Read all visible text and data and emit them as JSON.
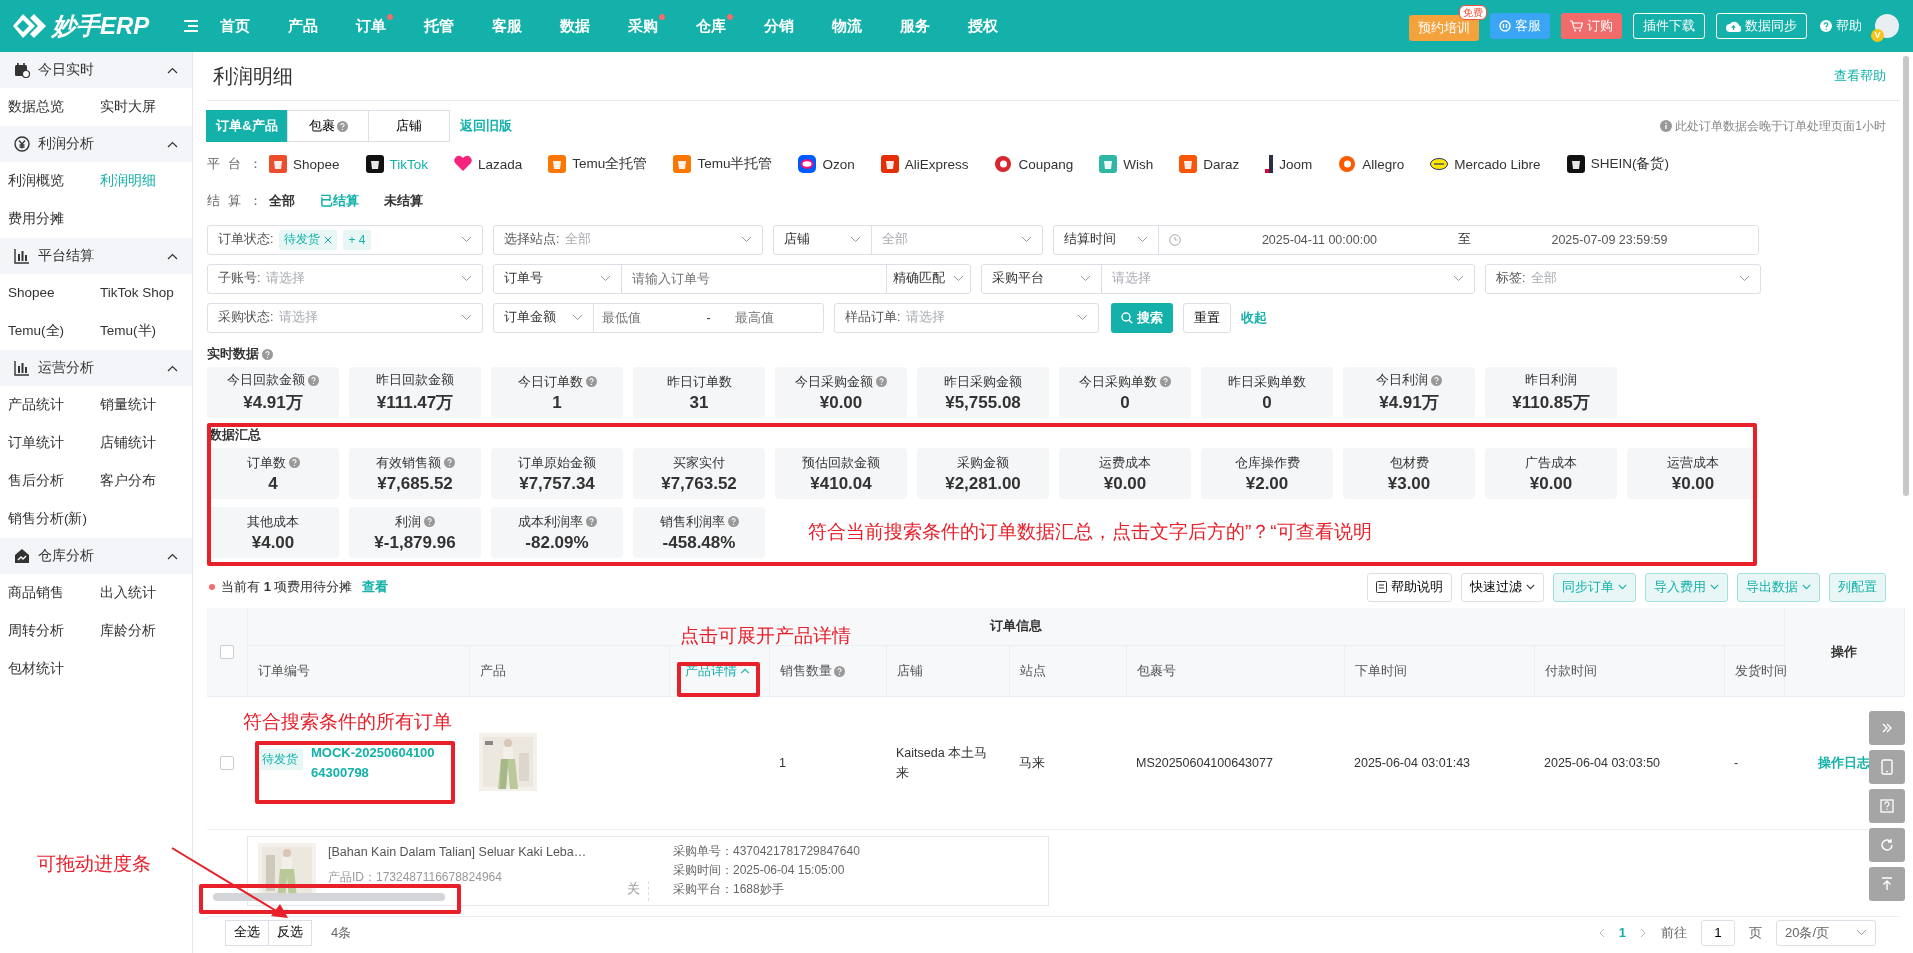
{
  "header": {
    "logo": "妙手ERP",
    "nav": [
      {
        "label": "首页",
        "dot": false
      },
      {
        "label": "产品",
        "dot": false
      },
      {
        "label": "订单",
        "dot": true
      },
      {
        "label": "托管",
        "dot": false
      },
      {
        "label": "客服",
        "dot": false
      },
      {
        "label": "数据",
        "dot": false
      },
      {
        "label": "采购",
        "dot": true
      },
      {
        "label": "仓库",
        "dot": true
      },
      {
        "label": "分销",
        "dot": false
      },
      {
        "label": "物流",
        "dot": false
      },
      {
        "label": "服务",
        "dot": false
      },
      {
        "label": "授权",
        "dot": false
      }
    ],
    "actions": [
      {
        "kind": "training",
        "label": "预约培训",
        "badge": "免费"
      },
      {
        "kind": "service",
        "label": "客服"
      },
      {
        "kind": "order",
        "label": "订购"
      },
      {
        "kind": "outline",
        "label": "插件下载"
      },
      {
        "kind": "sync",
        "label": "数据同步"
      },
      {
        "kind": "help",
        "label": "帮助"
      }
    ],
    "avatar_badge": "V"
  },
  "sidebar": {
    "sections": [
      {
        "title": "今日实时",
        "expanded": true,
        "items": [
          {
            "label": "数据总览",
            "selected": false
          },
          {
            "label": "实时大屏",
            "selected": false
          }
        ]
      },
      {
        "title": "利润分析",
        "expanded": true,
        "items": [
          {
            "label": "利润概览",
            "selected": false
          },
          {
            "label": "利润明细",
            "selected": true
          },
          {
            "label": "费用分摊",
            "selected": false
          }
        ]
      },
      {
        "title": "平台结算",
        "expanded": true,
        "items": [
          {
            "label": "Shopee",
            "selected": false
          },
          {
            "label": "TikTok Shop",
            "selected": false
          },
          {
            "label": "Temu(全)",
            "selected": false
          },
          {
            "label": "Temu(半)",
            "selected": false
          }
        ]
      },
      {
        "title": "运营分析",
        "expanded": true,
        "items": [
          {
            "label": "产品统计",
            "selected": false
          },
          {
            "label": "销量统计",
            "selected": false
          },
          {
            "label": "订单统计",
            "selected": false
          },
          {
            "label": "店铺统计",
            "selected": false
          },
          {
            "label": "售后分析",
            "selected": false
          },
          {
            "label": "客户分布",
            "selected": false
          },
          {
            "label": "销售分析(新)",
            "selected": false
          }
        ]
      },
      {
        "title": "仓库分析",
        "expanded": true,
        "items": [
          {
            "label": "商品销售",
            "selected": false
          },
          {
            "label": "出入统计",
            "selected": false
          },
          {
            "label": "周转分析",
            "selected": false
          },
          {
            "label": "库龄分析",
            "selected": false
          },
          {
            "label": "包材统计",
            "selected": false
          }
        ]
      }
    ]
  },
  "page": {
    "title": "利润明细",
    "help_link": "查看帮助",
    "tabs": [
      {
        "label": "订单&产品",
        "selected": true,
        "help": false
      },
      {
        "label": "包裹",
        "selected": false,
        "help": true
      },
      {
        "label": "店铺",
        "selected": false,
        "help": false
      }
    ],
    "legacy_link": "返回旧版",
    "notice": "此处订单数据会晚于订单处理页面1小时",
    "platform_label": "平台：",
    "platforms": [
      {
        "name": "Shopee",
        "selected": false
      },
      {
        "name": "TikTok",
        "selected": true
      },
      {
        "name": "Lazada",
        "selected": false
      },
      {
        "name": "Temu全托管",
        "selected": false
      },
      {
        "name": "Temu半托管",
        "selected": false
      },
      {
        "name": "Ozon",
        "selected": false
      },
      {
        "name": "AliExpress",
        "selected": false
      },
      {
        "name": "Coupang",
        "selected": false
      },
      {
        "name": "Wish",
        "selected": false
      },
      {
        "name": "Daraz",
        "selected": false
      },
      {
        "name": "Joom",
        "selected": false
      },
      {
        "name": "Allegro",
        "selected": false
      },
      {
        "name": "Mercado Libre",
        "selected": false
      },
      {
        "name": "SHEIN(备货)",
        "selected": false
      }
    ],
    "settlement_label": "结算：",
    "settlement_options": [
      {
        "label": "全部",
        "selected": false
      },
      {
        "label": "已结算",
        "selected": true
      },
      {
        "label": "未结算",
        "selected": false
      }
    ]
  },
  "filters": {
    "rows": [
      [
        {
          "kind": "select",
          "label": "订单状态:",
          "tags": [
            "待发货",
            "+ 4"
          ]
        },
        {
          "kind": "select",
          "label": "选择站点:",
          "placeholder": "全部"
        },
        {
          "kind": "combo",
          "option": "店铺",
          "placeholder": "全部"
        },
        {
          "kind": "daterange",
          "option": "结算时间",
          "start": "2025-04-11 00:00:00",
          "separator": "至",
          "end": "2025-07-09 23:59:59"
        }
      ],
      [
        {
          "kind": "select",
          "label": "子账号:",
          "placeholder": "请选择"
        },
        {
          "kind": "combo_input",
          "option": "订单号",
          "placeholder": "请输入订单号",
          "mode": "精确匹配"
        },
        {
          "kind": "combo",
          "option": "采购平台",
          "placeholder": "请选择"
        },
        {
          "kind": "select",
          "label": "标签:",
          "placeholder": "全部"
        }
      ],
      [
        {
          "kind": "select",
          "label": "采购状态:",
          "placeholder": "请选择"
        },
        {
          "kind": "range",
          "option": "订单金额",
          "min_placeholder": "最低值",
          "separator": "-",
          "max_placeholder": "最高值"
        },
        {
          "kind": "select",
          "label": "样品订单:",
          "placeholder": "请选择"
        }
      ]
    ],
    "search_button": "搜索",
    "reset_button": "重置",
    "collapse_link": "收起"
  },
  "realtime": {
    "title": "实时数据",
    "cards": [
      {
        "label": "今日回款金额",
        "help": true,
        "value": "¥4.91万"
      },
      {
        "label": "昨日回款金额",
        "help": false,
        "value": "¥111.47万"
      },
      {
        "label": "今日订单数",
        "help": true,
        "value": "1"
      },
      {
        "label": "昨日订单数",
        "help": false,
        "value": "31"
      },
      {
        "label": "今日采购金额",
        "help": true,
        "value": "¥0.00"
      },
      {
        "label": "昨日采购金额",
        "help": false,
        "value": "¥5,755.08"
      },
      {
        "label": "今日采购单数",
        "help": true,
        "value": "0"
      },
      {
        "label": "昨日采购单数",
        "help": false,
        "value": "0"
      },
      {
        "label": "今日利润",
        "help": true,
        "value": "¥4.91万"
      },
      {
        "label": "昨日利润",
        "help": false,
        "value": "¥110.85万"
      }
    ]
  },
  "summary": {
    "title": "数据汇总",
    "cards": [
      {
        "label": "订单数",
        "help": true,
        "value": "4"
      },
      {
        "label": "有效销售额",
        "help": true,
        "value": "¥7,685.52"
      },
      {
        "label": "订单原始金额",
        "help": false,
        "value": "¥7,757.34"
      },
      {
        "label": "买家实付",
        "help": false,
        "value": "¥7,763.52"
      },
      {
        "label": "预估回款金额",
        "help": false,
        "value": "¥410.04"
      },
      {
        "label": "采购金额",
        "help": false,
        "value": "¥2,281.00"
      },
      {
        "label": "运费成本",
        "help": false,
        "value": "¥0.00"
      },
      {
        "label": "仓库操作费",
        "help": false,
        "value": "¥2.00"
      },
      {
        "label": "包材费",
        "help": false,
        "value": "¥3.00"
      },
      {
        "label": "广告成本",
        "help": false,
        "value": "¥0.00"
      },
      {
        "label": "运营成本",
        "help": false,
        "value": "¥0.00"
      },
      {
        "label": "其他成本",
        "help": false,
        "value": "¥4.00"
      },
      {
        "label": "利润",
        "help": true,
        "value": "¥-1,879.96"
      },
      {
        "label": "成本利润率",
        "help": true,
        "value": "-82.09%"
      },
      {
        "label": "销售利润率",
        "help": true,
        "value": "-458.48%"
      }
    ]
  },
  "toolbar": {
    "notice": "当前有 **1** 项费用待分摊",
    "notice_link": "查看",
    "buttons": [
      {
        "kind": "doc",
        "label": "帮助说明"
      },
      {
        "kind": "plain_menu",
        "label": "快速过滤"
      },
      {
        "kind": "accent_menu",
        "label": "同步订单"
      },
      {
        "kind": "accent_menu",
        "label": "导入费用"
      },
      {
        "kind": "accent_menu",
        "label": "导出数据"
      },
      {
        "kind": "accent",
        "label": "列配置"
      }
    ]
  },
  "table": {
    "group_title": "订单信息",
    "action_title": "操作",
    "all_selected": false,
    "detail_expanded": true,
    "columns": [
      {
        "label": "订单编号",
        "kind": "text",
        "help": false
      },
      {
        "label": "产品",
        "kind": "text",
        "help": false
      },
      {
        "label": "产品详情",
        "kind": "toggle"
      },
      {
        "label": "销售数量",
        "kind": "text",
        "help": true
      },
      {
        "label": "店铺",
        "kind": "text",
        "help": false
      },
      {
        "label": "站点",
        "kind": "text",
        "help": false
      },
      {
        "label": "包裹号",
        "kind": "text",
        "help": false
      },
      {
        "label": "下单时间",
        "kind": "text",
        "help": false
      },
      {
        "label": "付款时间",
        "kind": "text",
        "help": false
      },
      {
        "label": "发货时间",
        "kind": "text",
        "help": false
      }
    ],
    "rows": [
      {
        "selected": false,
        "status": "待发货",
        "order_no": "MOCK-2025060410064300798",
        "quantity": "1",
        "store": "Kaitseda 本土马来",
        "site": "马来",
        "package_no": "MS20250604100643077",
        "order_time": "2025-06-04 03:01:43",
        "pay_time": "2025-06-04 03:03:50",
        "ship_time": "-",
        "action": "操作日志",
        "detail": {
          "title": "[Bahan Kain Dalam Talian] Seluar Kaki Leba…",
          "product_id": "产品ID：1732487116678824964",
          "link_label": "关",
          "purchase": [
            "采购单号：4370421781729847640",
            "采购时间：2025-06-04 15:05:00",
            "采购平台：1688妙手"
          ]
        }
      }
    ]
  },
  "footer": {
    "select_all": "全选",
    "invert": "反选",
    "count": "4条",
    "pages": [
      {
        "label": "1",
        "selected": true
      }
    ],
    "goto_label": "前往",
    "goto_value": "1",
    "page_unit": "页",
    "page_size": "20条/页"
  },
  "annotations": [
    {
      "kind": "summary",
      "text": "符合当前搜索条件的订单数据汇总，点击文字后方的”？“可查看说明"
    },
    {
      "kind": "detail_toggle",
      "text": "点击可展开产品详情"
    },
    {
      "kind": "orders",
      "text": "符合搜索条件的所有订单"
    },
    {
      "kind": "scrollbar",
      "text": "可拖动进度条"
    }
  ]
}
